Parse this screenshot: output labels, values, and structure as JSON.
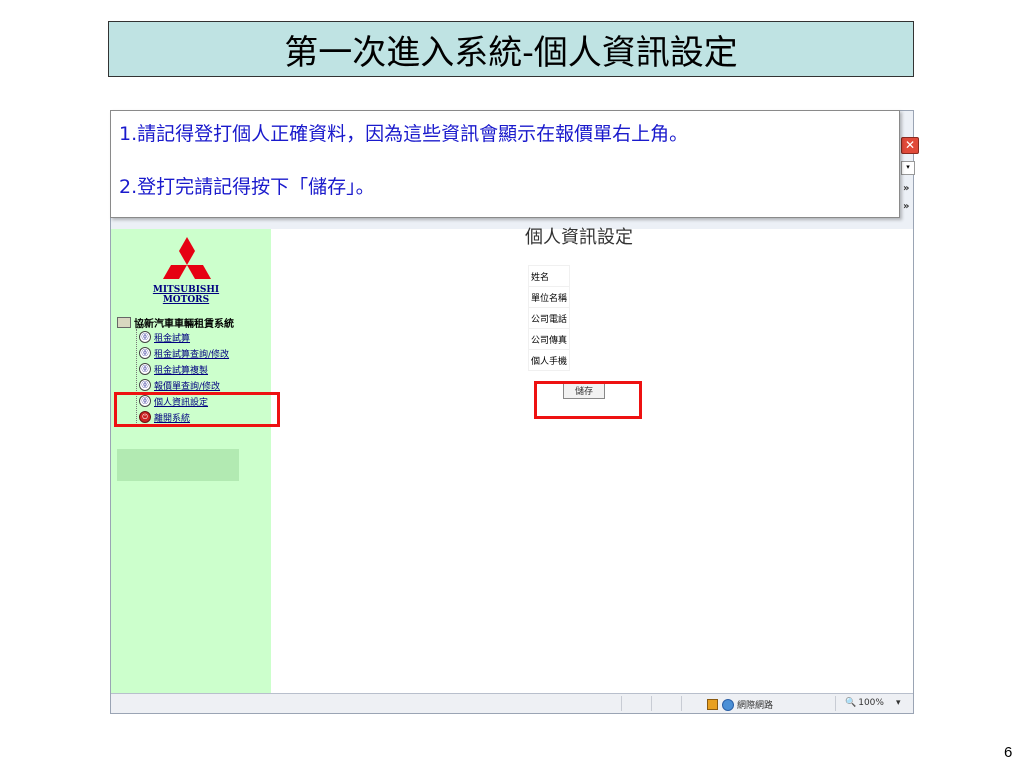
{
  "slide": {
    "title": "第一次進入系統-個人資訊設定",
    "page_number": "6"
  },
  "callout": {
    "line1_num": "1.",
    "line1_text": "請記得登打個人正確資料，因為這些資訊會顯示在報價單右上角。",
    "line2_num": "2.",
    "line2_text": "登打完請記得按下「儲存」。"
  },
  "window": {
    "close_glyph": "✕",
    "toolbar_more_1": "»",
    "toolbar_more_2": "»"
  },
  "sidebar": {
    "logo_line1": "MITSUBISHI",
    "logo_line2": "MOTORS",
    "root_label": "協新汽車車輛租賃系統",
    "items": [
      {
        "label": "租金試算",
        "icon": "⓪"
      },
      {
        "label": "租金試算查詢/修改",
        "icon": "⓪"
      },
      {
        "label": "租金試算複製",
        "icon": "⓪"
      },
      {
        "label": "報價單查詢/修改",
        "icon": "⓪"
      },
      {
        "label": "個人資訊設定",
        "icon": "⓪"
      },
      {
        "label": "離開系統",
        "icon": "⏻"
      }
    ]
  },
  "main": {
    "heading": "個人資訊設定",
    "fields": [
      "姓名",
      "單位名稱",
      "公司電話",
      "公司傳真",
      "個人手機"
    ],
    "save_label": "儲存"
  },
  "status": {
    "zone": "網際網路",
    "zoom": "100%",
    "zoom_dropdown": "▾"
  },
  "colors": {
    "title_bg": "#bfe3e3",
    "sidebar_bg": "#ccffcc",
    "highlight": "#ee1111",
    "callout_text": "#1a1acc"
  }
}
